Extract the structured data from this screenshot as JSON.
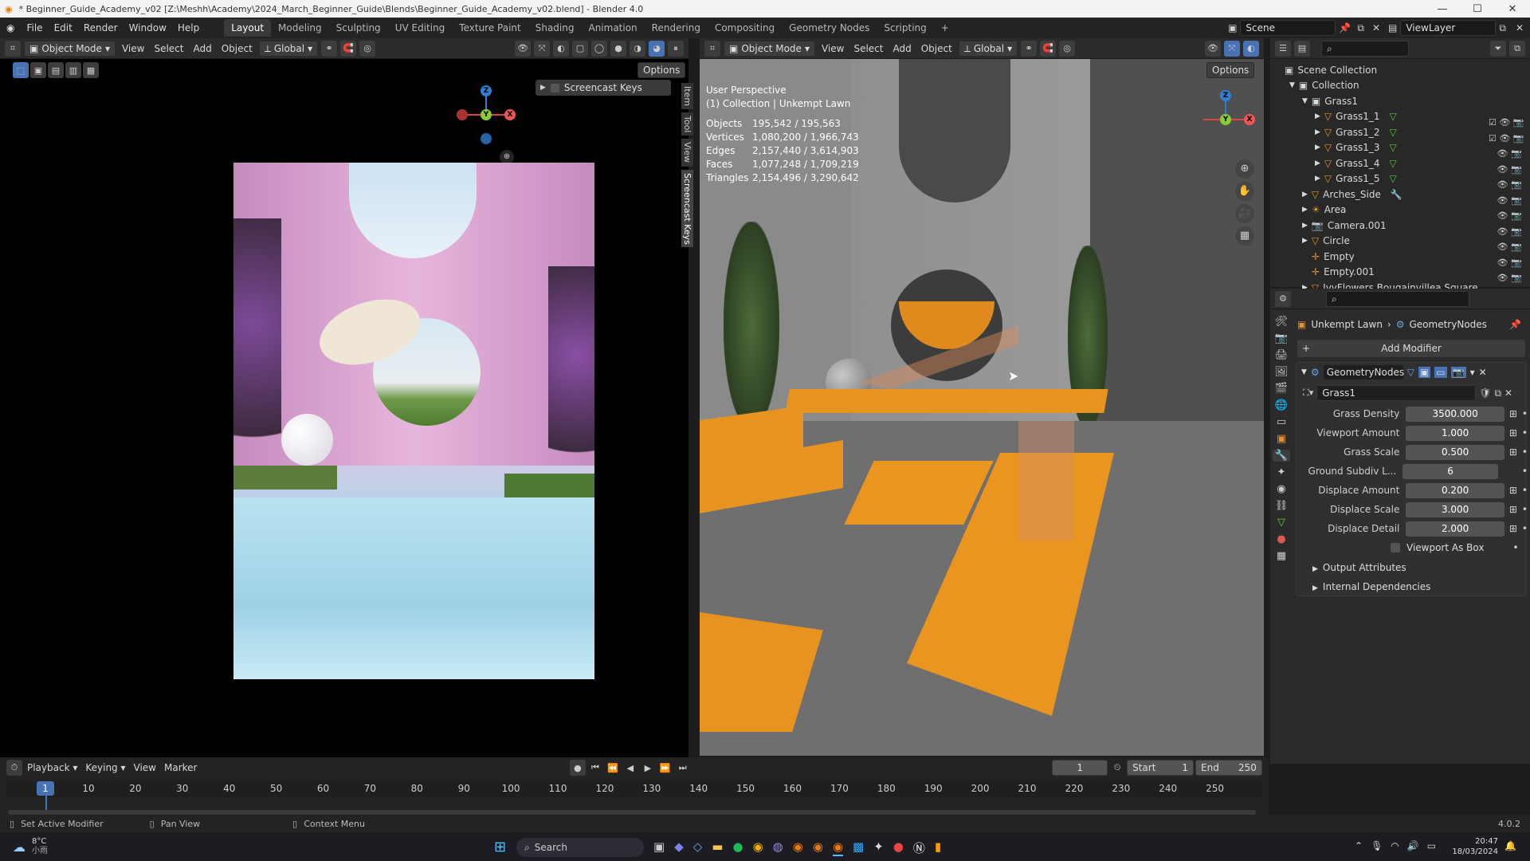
{
  "window": {
    "title": "* Beginner_Guide_Academy_v02 [Z:\\Meshh\\Academy\\2024_March_Beginner_Guide\\Blends\\Beginner_Guide_Academy_v02.blend] - Blender 4.0"
  },
  "menu": [
    "File",
    "Edit",
    "Render",
    "Window",
    "Help"
  ],
  "workspaces": [
    "Layout",
    "Modeling",
    "Sculpting",
    "UV Editing",
    "Texture Paint",
    "Shading",
    "Animation",
    "Rendering",
    "Compositing",
    "Geometry Nodes",
    "Scripting"
  ],
  "scene_name": "Scene",
  "view_layer": "ViewLayer",
  "left_viewport": {
    "mode": "Object Mode",
    "menus": [
      "View",
      "Select",
      "Add",
      "Object"
    ],
    "orientation": "Global",
    "options": "Options",
    "panel_title": "Screencast Keys",
    "side_tabs": [
      "Item",
      "Tool",
      "View",
      "Screencast Keys"
    ]
  },
  "right_viewport": {
    "mode": "Object Mode",
    "menus": [
      "View",
      "Select",
      "Add",
      "Object"
    ],
    "orientation": "Global",
    "options": "Options",
    "overlay_title": "User Perspective",
    "overlay_sub": "(1) Collection | Unkempt Lawn",
    "stats": [
      {
        "label": "Objects",
        "value": "195,542 / 195,563"
      },
      {
        "label": "Vertices",
        "value": "1,080,200 / 1,966,743"
      },
      {
        "label": "Edges",
        "value": "2,157,440 / 3,614,903"
      },
      {
        "label": "Faces",
        "value": "1,077,248 / 1,709,219"
      },
      {
        "label": "Triangles",
        "value": "2,154,496 / 3,290,642"
      }
    ]
  },
  "gizmo": {
    "x": "X",
    "y": "Y",
    "z": "Z"
  },
  "outliner": {
    "root": "Scene Collection",
    "items": [
      {
        "name": "Collection"
      },
      {
        "name": "Grass1"
      },
      {
        "name": "Grass1_1"
      },
      {
        "name": "Grass1_2"
      },
      {
        "name": "Grass1_3"
      },
      {
        "name": "Grass1_4"
      },
      {
        "name": "Grass1_5"
      },
      {
        "name": "Arches_Side"
      },
      {
        "name": "Area"
      },
      {
        "name": "Camera.001"
      },
      {
        "name": "Circle"
      },
      {
        "name": "Empty"
      },
      {
        "name": "Empty.001"
      },
      {
        "name": "IvyFlowers Bougainvillea Square"
      }
    ]
  },
  "properties": {
    "object": "Unkempt Lawn",
    "modifier_path": "GeometryNodes",
    "add_modifier": "Add Modifier",
    "modifier_name": "GeometryNodes",
    "node_group": "Grass1",
    "fields": [
      {
        "label": "Grass Density",
        "value": "3500.000"
      },
      {
        "label": "Viewport Amount",
        "value": "1.000"
      },
      {
        "label": "Grass Scale",
        "value": "0.500"
      },
      {
        "label": "Ground Subdiv L...",
        "value": "6"
      },
      {
        "label": "Displace Amount",
        "value": "0.200"
      },
      {
        "label": "Displace Scale",
        "value": "3.000"
      },
      {
        "label": "Displace Detail",
        "value": "2.000"
      }
    ],
    "checkbox": "Viewport As Box",
    "panels": [
      "Output Attributes",
      "Internal Dependencies"
    ]
  },
  "timeline": {
    "menus": [
      "Playback",
      "Keying",
      "View",
      "Marker"
    ],
    "current": "1",
    "start_label": "Start",
    "start": "1",
    "end_label": "End",
    "end": "250",
    "ticks": [
      "1",
      "10",
      "20",
      "30",
      "40",
      "50",
      "60",
      "70",
      "80",
      "90",
      "100",
      "110",
      "120",
      "130",
      "140",
      "150",
      "160",
      "170",
      "180",
      "190",
      "200",
      "210",
      "220",
      "230",
      "240",
      "250"
    ]
  },
  "statusbar": {
    "hints": [
      "Set Active Modifier",
      "Pan View",
      "Context Menu"
    ],
    "version": "4.0.2"
  },
  "taskbar": {
    "weather_temp": "8°C",
    "weather_sub": "小雨",
    "search": "Search",
    "time": "20:47",
    "date": "18/03/2024"
  }
}
